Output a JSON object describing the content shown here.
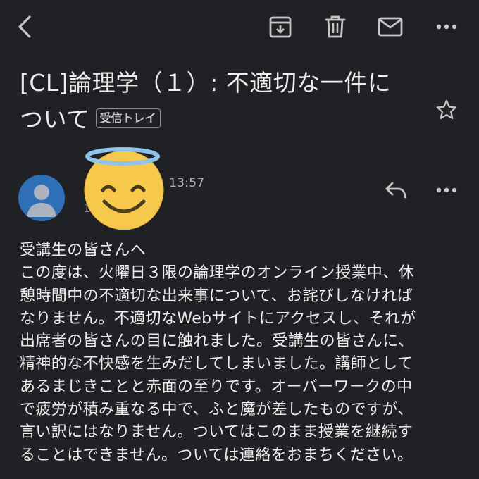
{
  "toolbar": {
    "back_icon": "back-arrow-icon",
    "archive_icon": "archive-icon",
    "delete_icon": "trash-icon",
    "mark_unread_icon": "mail-icon",
    "more_icon": "more-horiz-icon"
  },
  "email": {
    "subject_line1": "[CL]論理学（１）: 不適切な一件に",
    "subject_line2": "ついて",
    "label": "受信トレイ",
    "star_icon": "star-outline-icon"
  },
  "sender": {
    "avatar_icon": "person-avatar-icon",
    "avatar_color": "#2f6fb8",
    "sticker_icon": "smiling-face-with-halo-emoji",
    "time": "13:57",
    "name_fragment": "1",
    "reply_icon": "reply-icon",
    "more_icon": "more-horiz-icon"
  },
  "body": {
    "lines": [
      "受講生の皆さんへ",
      "この度は、火曜日３限の論理学のオンライン授業中、休",
      "憩時間中の不適切な出来事について、お詫びしなければ",
      "なりません。不適切なWebサイトにアクセスし、それが",
      "出席者の皆さんの目に触れました。受講生の皆さんに、",
      "精神的な不快感を生みだしてしまいました。講師として",
      "あるまじきことと赤面の至りです。オーバーワークの中",
      "で疲労が積み重なる中で、ふと魔が差したものですが、",
      "言い訳にはなりません。ついてはこのまま授業を継続す",
      "ることはできません。ついては連絡をおまちください。"
    ]
  },
  "colors": {
    "background": "#202124",
    "text": "#ececec",
    "icon": "#c4c7c5"
  }
}
